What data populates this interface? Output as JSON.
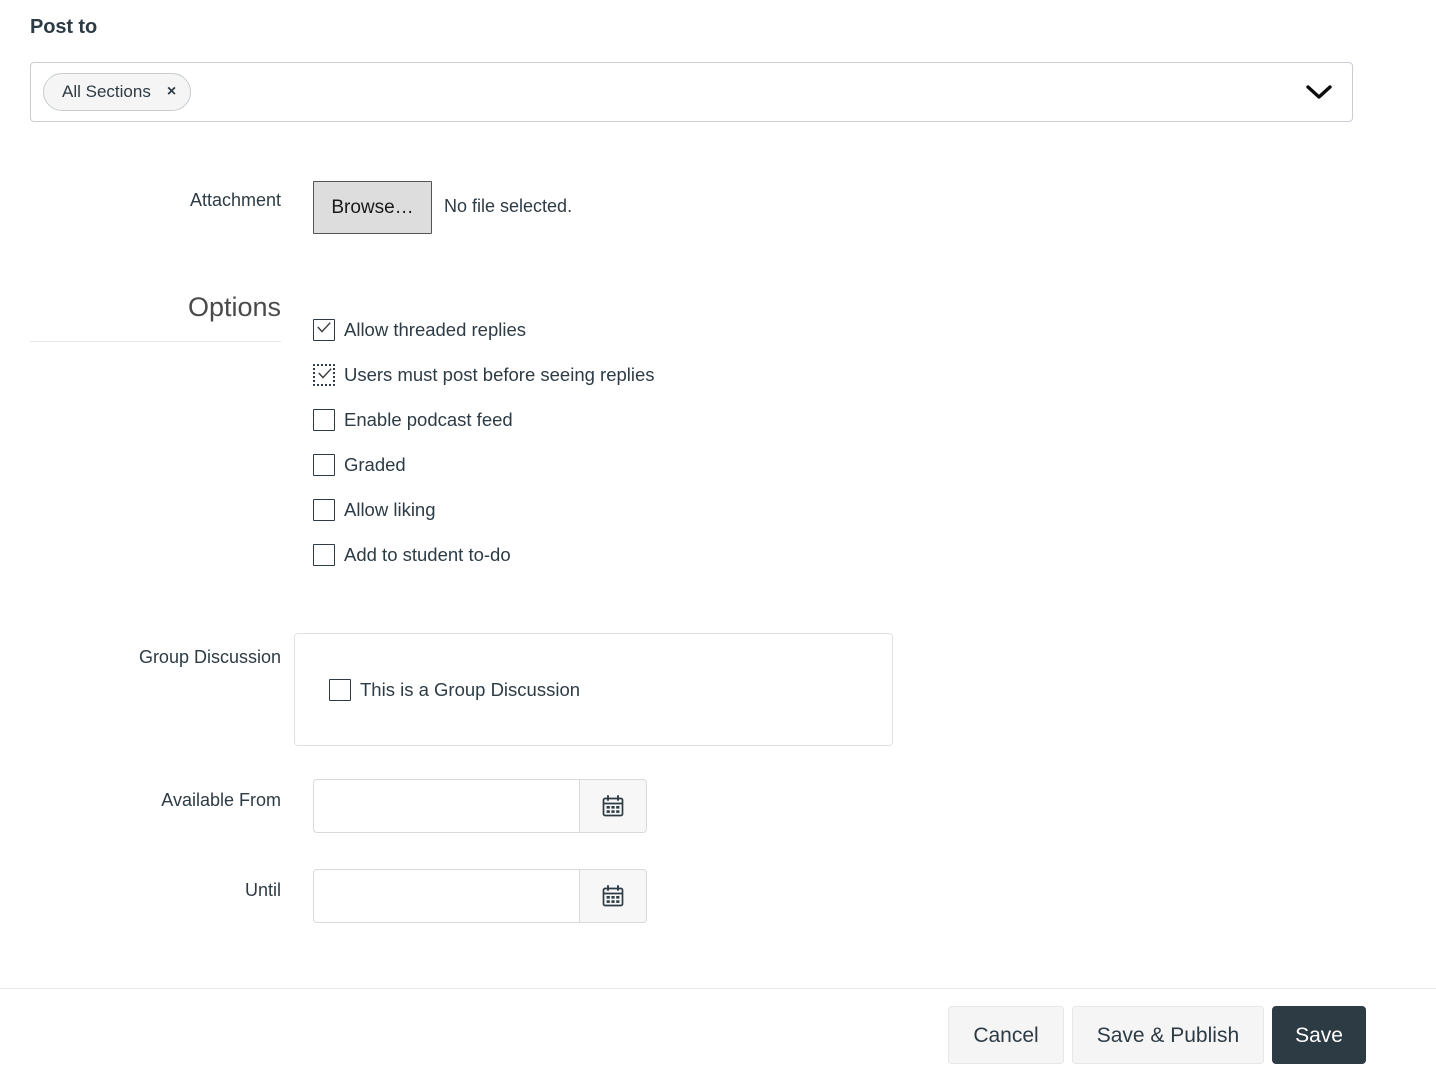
{
  "post_to": {
    "heading": "Post to",
    "selected_pill": "All Sections",
    "remove_icon": "×",
    "dropdown_icon": "chevron-down-icon"
  },
  "attachment": {
    "label": "Attachment",
    "browse_label": "Browse…",
    "file_status": "No file selected."
  },
  "options": {
    "heading": "Options",
    "items": [
      {
        "label": "Allow threaded replies",
        "checked": true,
        "focused": false
      },
      {
        "label": "Users must post before seeing replies",
        "checked": true,
        "focused": true
      },
      {
        "label": "Enable podcast feed",
        "checked": false,
        "focused": false
      },
      {
        "label": "Graded",
        "checked": false,
        "focused": false
      },
      {
        "label": "Allow liking",
        "checked": false,
        "focused": false
      },
      {
        "label": "Add to student to-do",
        "checked": false,
        "focused": false
      }
    ]
  },
  "group_discussion": {
    "label": "Group Discussion",
    "checkbox_label": "This is a Group Discussion",
    "checked": false
  },
  "available_from": {
    "label": "Available From",
    "value": "",
    "placeholder": "",
    "calendar_icon": "calendar-icon"
  },
  "until": {
    "label": "Until",
    "value": "",
    "placeholder": "",
    "calendar_icon": "calendar-icon"
  },
  "footer": {
    "cancel_label": "Cancel",
    "save_publish_label": "Save & Publish",
    "save_label": "Save"
  },
  "colors": {
    "text": "#2d3b45",
    "primary_button": "#2d3b45",
    "border": "#c7cdd1",
    "browse_button_bg": "#dddddd"
  }
}
